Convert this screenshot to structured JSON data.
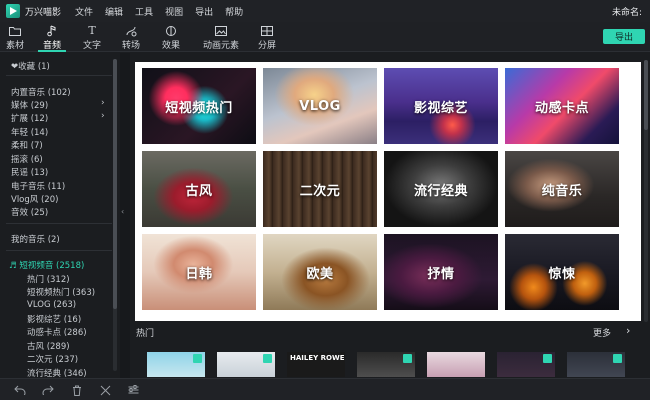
{
  "app": {
    "name": "万兴喵影",
    "project_name": "未命名:"
  },
  "menu": [
    "文件",
    "编辑",
    "工具",
    "视图",
    "导出",
    "帮助"
  ],
  "toolbar": {
    "tabs": [
      {
        "label": "素材",
        "icon": "folder-icon"
      },
      {
        "label": "音频",
        "icon": "music-note-icon",
        "active": true
      },
      {
        "label": "文字",
        "icon": "text-icon"
      },
      {
        "label": "转场",
        "icon": "transition-icon"
      },
      {
        "label": "效果",
        "icon": "effects-icon"
      },
      {
        "label": "动画元素",
        "icon": "image-icon"
      },
      {
        "label": "分屏",
        "icon": "split-screen-icon"
      }
    ],
    "export_label": "导出"
  },
  "sidebar": {
    "favorites": "❤收藏 (1)",
    "categories": [
      {
        "label": "内置音乐 (102)"
      },
      {
        "label": "媒体 (29)",
        "has_arrow": true
      },
      {
        "label": "扩展 (12)",
        "has_arrow": true
      },
      {
        "label": "年轻 (14)"
      },
      {
        "label": "柔和 (7)"
      },
      {
        "label": "摇滚 (6)"
      },
      {
        "label": "民谣 (13)"
      },
      {
        "label": "电子音乐 (11)"
      },
      {
        "label": "Vlog风 (20)"
      },
      {
        "label": "音效 (25)"
      }
    ],
    "my_music": "我的音乐 (2)",
    "expanded_group": "♬ 短视频音 (2518)",
    "subcategories": [
      {
        "label": "热门 (312)"
      },
      {
        "label": "短视频热门 (363)"
      },
      {
        "label": "VLOG (263)"
      },
      {
        "label": "影视综艺 (16)"
      },
      {
        "label": "动感卡点 (286)"
      },
      {
        "label": "古风 (289)"
      },
      {
        "label": "二次元 (237)"
      },
      {
        "label": "流行经典 (346)"
      }
    ]
  },
  "grid": {
    "tiles": [
      {
        "label": "短视频热门"
      },
      {
        "label": "VLOG"
      },
      {
        "label": "影视综艺"
      },
      {
        "label": "动感卡点"
      },
      {
        "label": "古风"
      },
      {
        "label": "二次元"
      },
      {
        "label": "流行经典"
      },
      {
        "label": "纯音乐"
      },
      {
        "label": "日韩"
      },
      {
        "label": "欧美"
      },
      {
        "label": "抒情"
      },
      {
        "label": "惊悚"
      }
    ]
  },
  "hot_section": {
    "label": "热门",
    "more_label": "更多"
  },
  "thumbnails": [
    "",
    "",
    "HAILEY ROWE",
    "",
    "",
    "",
    ""
  ],
  "bottom_toolbar": [
    "undo-icon",
    "redo-icon",
    "delete-icon",
    "cut-icon",
    "adjust-icon"
  ]
}
